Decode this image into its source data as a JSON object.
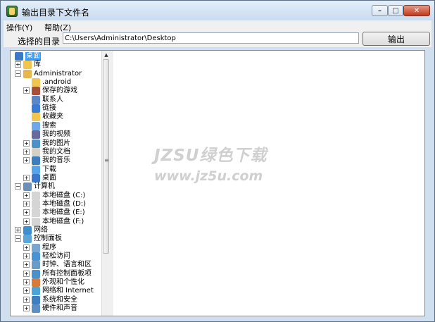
{
  "window": {
    "title": "输出目录下文件名",
    "colors": {
      "title_bar": "#c9dcf0",
      "close_button": "#c0391b",
      "selection": "#3399ff"
    }
  },
  "menu": {
    "items": [
      "操作(Y)",
      "帮助(Z)"
    ]
  },
  "toolbar": {
    "dir_label": "选择的目录",
    "path_value": "C:\\Users\\Administrator\\Desktop",
    "export_label": "输出"
  },
  "tree": {
    "nodes": [
      {
        "label": "桌面",
        "selected": true
      },
      {
        "label": "库"
      },
      {
        "label": "Administrator"
      },
      {
        "label": ".android"
      },
      {
        "label": "保存的游戏"
      },
      {
        "label": "联系人"
      },
      {
        "label": "链接"
      },
      {
        "label": "收藏夹"
      },
      {
        "label": "搜索"
      },
      {
        "label": "我的视频"
      },
      {
        "label": "我的图片"
      },
      {
        "label": "我的文档"
      },
      {
        "label": "我的音乐"
      },
      {
        "label": "下载"
      },
      {
        "label": "桌面"
      },
      {
        "label": "计算机"
      },
      {
        "label": "本地磁盘 (C:)"
      },
      {
        "label": "本地磁盘 (D:)"
      },
      {
        "label": "本地磁盘 (E:)"
      },
      {
        "label": "本地磁盘 (F:)"
      },
      {
        "label": "网络"
      },
      {
        "label": "控制面板"
      },
      {
        "label": "程序"
      },
      {
        "label": "轻松访问"
      },
      {
        "label": "时钟、语言和区"
      },
      {
        "label": "所有控制面板项"
      },
      {
        "label": "外观和个性化"
      },
      {
        "label": "网络和 Internet"
      },
      {
        "label": "系统和安全"
      },
      {
        "label": "硬件和声音"
      }
    ]
  },
  "watermark": {
    "line1": "JZSU绿色下载",
    "line2": "www.jz5u.com"
  }
}
